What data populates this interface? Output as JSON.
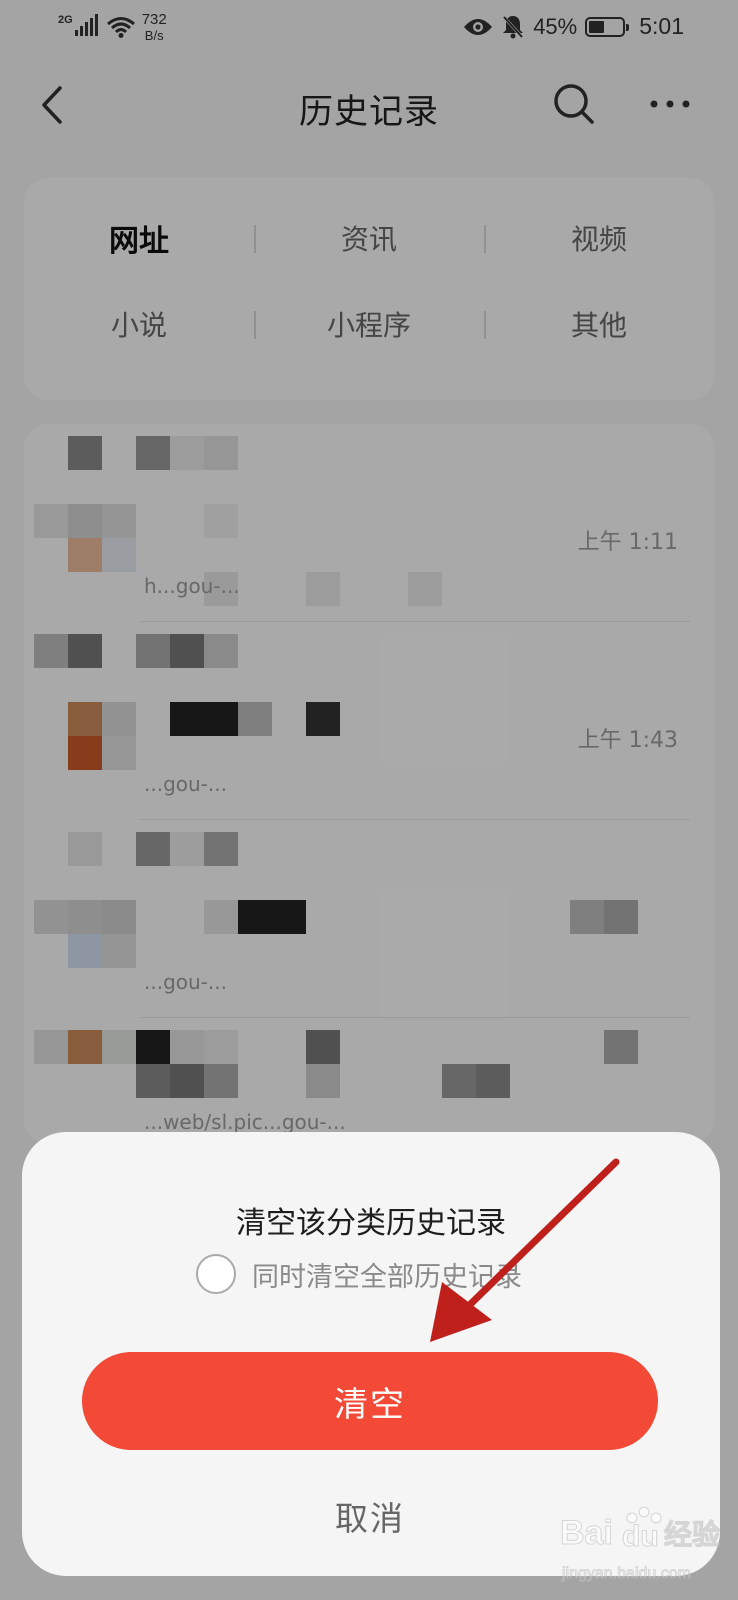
{
  "status_bar": {
    "network": "2G",
    "speed_value": "732",
    "speed_unit": "B/s",
    "battery_percent": "45%",
    "battery_level": 0.45,
    "time": "5:01",
    "icons": [
      "signal-icon",
      "wifi-icon",
      "eye-icon",
      "bell-off-icon",
      "battery-icon"
    ]
  },
  "header": {
    "title": "历史记录",
    "back_icon": "chevron-left-icon",
    "search_icon": "search-icon",
    "more_icon": "more-horizontal-icon"
  },
  "categories": {
    "row1": [
      "网址",
      "资讯",
      "视频"
    ],
    "row2": [
      "小说",
      "小程序",
      "其他"
    ],
    "active": "网址"
  },
  "history": {
    "items": [
      {
        "time": "上午 1:11",
        "url": "h...gou-..."
      },
      {
        "time": "上午 1:43",
        "url": "...gou-..."
      },
      {
        "time": "",
        "url": "...gou-..."
      },
      {
        "time": "",
        "url": "...web/sl.pic...gou-..."
      }
    ]
  },
  "dialog": {
    "title": "清空该分类历史记录",
    "checkbox_label": "同时清空全部历史记录",
    "checkbox_checked": false,
    "confirm_label": "清空",
    "cancel_label": "取消"
  },
  "colors": {
    "accent": "#f24a36",
    "annotation_arrow": "#c0201c",
    "overlay": "rgba(0,0,0,0.32)"
  },
  "watermark": {
    "text": "Baidu经验",
    "sub": "jingyan.baidu.com"
  }
}
